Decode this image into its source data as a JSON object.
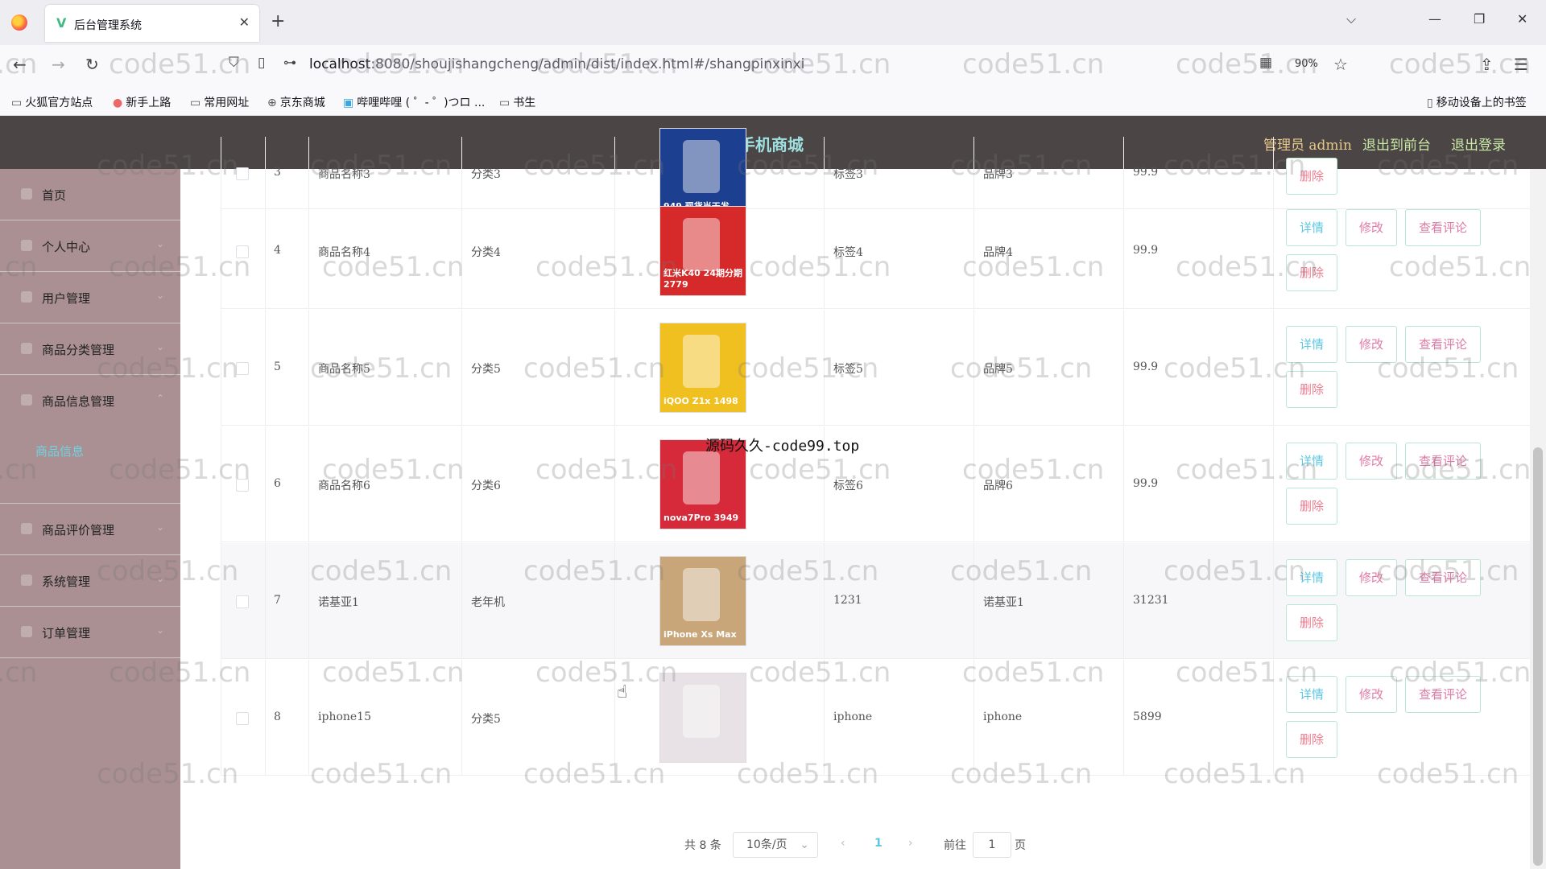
{
  "browser": {
    "tab_title": "后台管理系统",
    "url_host": "localhost",
    "url_path": ":8080/shoujishangcheng/admin/dist/index.html#/shangpinxinxi",
    "zoom": "90%"
  },
  "bookmarks": [
    "火狐官方站点",
    "新手上路",
    "常用网址",
    "京东商城",
    "哔哩哔哩 ( ゜- ゜)つロ ...",
    "书生",
    "移动设备上的书签"
  ],
  "app": {
    "title": "手机商城",
    "user_label": "管理员 admin",
    "front_link": "退出到前台",
    "logout_link": "退出登录"
  },
  "sidebar": {
    "items": [
      "首页",
      "个人中心",
      "用户管理",
      "商品分类管理",
      "商品信息管理",
      "商品评价管理",
      "系统管理",
      "订单管理"
    ],
    "active_sub": "商品信息"
  },
  "table": {
    "buttons": {
      "detail": "详情",
      "edit": "修改",
      "review": "查看评论",
      "delete": "删除"
    },
    "rows": [
      {
        "index": "3",
        "name": "商品名称3",
        "category": "分类3",
        "tag": "标签3",
        "brand": "品牌3",
        "price": "99.9",
        "thumb_color": "#1d3f8f",
        "thumb_text": "949 现货当天发"
      },
      {
        "index": "4",
        "name": "商品名称4",
        "category": "分类4",
        "tag": "标签4",
        "brand": "品牌4",
        "price": "99.9",
        "thumb_color": "#d62a2a",
        "thumb_text": "红米K40 24期分期 2779"
      },
      {
        "index": "5",
        "name": "商品名称5",
        "category": "分类5",
        "tag": "标签5",
        "brand": "品牌5",
        "price": "99.9",
        "thumb_color": "#f0c020",
        "thumb_text": "iQOO Z1x 1498"
      },
      {
        "index": "6",
        "name": "商品名称6",
        "category": "分类6",
        "tag": "标签6",
        "brand": "品牌6",
        "price": "99.9",
        "thumb_color": "#d62a3a",
        "thumb_text": "nova7Pro 3949"
      },
      {
        "index": "7",
        "name": "诺基亚1",
        "category": "老年机",
        "tag": "1231",
        "brand": "诺基亚1",
        "price": "31231",
        "thumb_color": "#c9a67a",
        "thumb_text": "iPhone Xs Max"
      },
      {
        "index": "8",
        "name": "iphone15",
        "category": "分类5",
        "tag": "iphone",
        "brand": "iphone",
        "price": "5899",
        "thumb_color": "#e8e2e6",
        "thumb_text": ""
      }
    ]
  },
  "pagination": {
    "total": "共 8 条",
    "page_size": "10条/页",
    "current": "1",
    "goto_before": "前往",
    "goto_value": "1",
    "goto_after": "页"
  },
  "overlay_text": "源码久久-code99.top",
  "watermark": "code51.cn"
}
